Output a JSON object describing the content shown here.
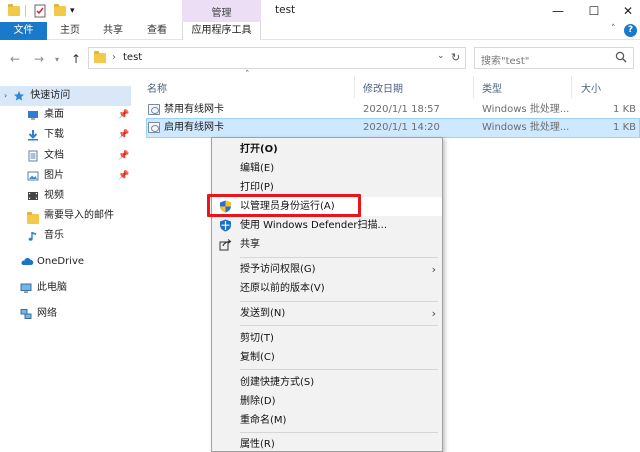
{
  "window": {
    "title": "test",
    "contextual_tab_group": "管理",
    "controls": {
      "minimize": "—",
      "maximize": "☐",
      "close": "✕"
    }
  },
  "ribbon": {
    "tabs": [
      "文件",
      "主页",
      "共享",
      "查看",
      "应用程序工具"
    ]
  },
  "address": {
    "path_separator": "›",
    "path": "test",
    "refresh_glyph": "↻",
    "search_placeholder": "搜索\"test\""
  },
  "sidebar": {
    "items": [
      {
        "label": "快速访问",
        "icon": "star-icon"
      },
      {
        "label": "桌面",
        "icon": "desktop-icon",
        "pinned": true
      },
      {
        "label": "下载",
        "icon": "download-icon",
        "pinned": true
      },
      {
        "label": "文档",
        "icon": "document-icon",
        "pinned": true
      },
      {
        "label": "图片",
        "icon": "picture-icon",
        "pinned": true
      },
      {
        "label": "视频",
        "icon": "video-icon"
      },
      {
        "label": "需要导入的邮件",
        "icon": "folder-icon"
      },
      {
        "label": "音乐",
        "icon": "music-icon"
      },
      {
        "label": "OneDrive",
        "icon": "cloud-icon"
      },
      {
        "label": "此电脑",
        "icon": "computer-icon"
      },
      {
        "label": "网络",
        "icon": "network-icon"
      }
    ]
  },
  "file_list": {
    "columns": [
      "名称",
      "修改日期",
      "类型",
      "大小"
    ],
    "rows": [
      {
        "name": "禁用有线网卡",
        "modified": "2020/1/1 18:57",
        "type": "Windows 批处理...",
        "size": "1 KB"
      },
      {
        "name": "启用有线网卡",
        "modified": "2020/1/1 14:20",
        "type": "Windows 批处理...",
        "size": "1 KB",
        "selected": true
      }
    ]
  },
  "context_menu": {
    "items": [
      {
        "label": "打开(O)",
        "bold": true
      },
      {
        "label": "编辑(E)"
      },
      {
        "label": "打印(P)"
      },
      {
        "label": "以管理员身份运行(A)",
        "icon": "uac-shield-icon",
        "highlighted": true
      },
      {
        "label": "使用 Windows Defender扫描...",
        "icon": "defender-icon"
      },
      {
        "label": "共享",
        "icon": "share-icon"
      },
      {
        "label": "授予访问权限(G)",
        "submenu": true
      },
      {
        "label": "还原以前的版本(V)"
      },
      {
        "label": "发送到(N)",
        "submenu": true
      },
      {
        "label": "剪切(T)"
      },
      {
        "label": "复制(C)"
      },
      {
        "label": "创建快捷方式(S)"
      },
      {
        "label": "删除(D)"
      },
      {
        "label": "重命名(M)"
      },
      {
        "label": "属性(R)"
      }
    ]
  },
  "colors": {
    "file_tab": "#1979ca",
    "selection": "#cde8ff",
    "highlight_box": "#e8151b",
    "contextual_tab": "#ecdff5"
  }
}
